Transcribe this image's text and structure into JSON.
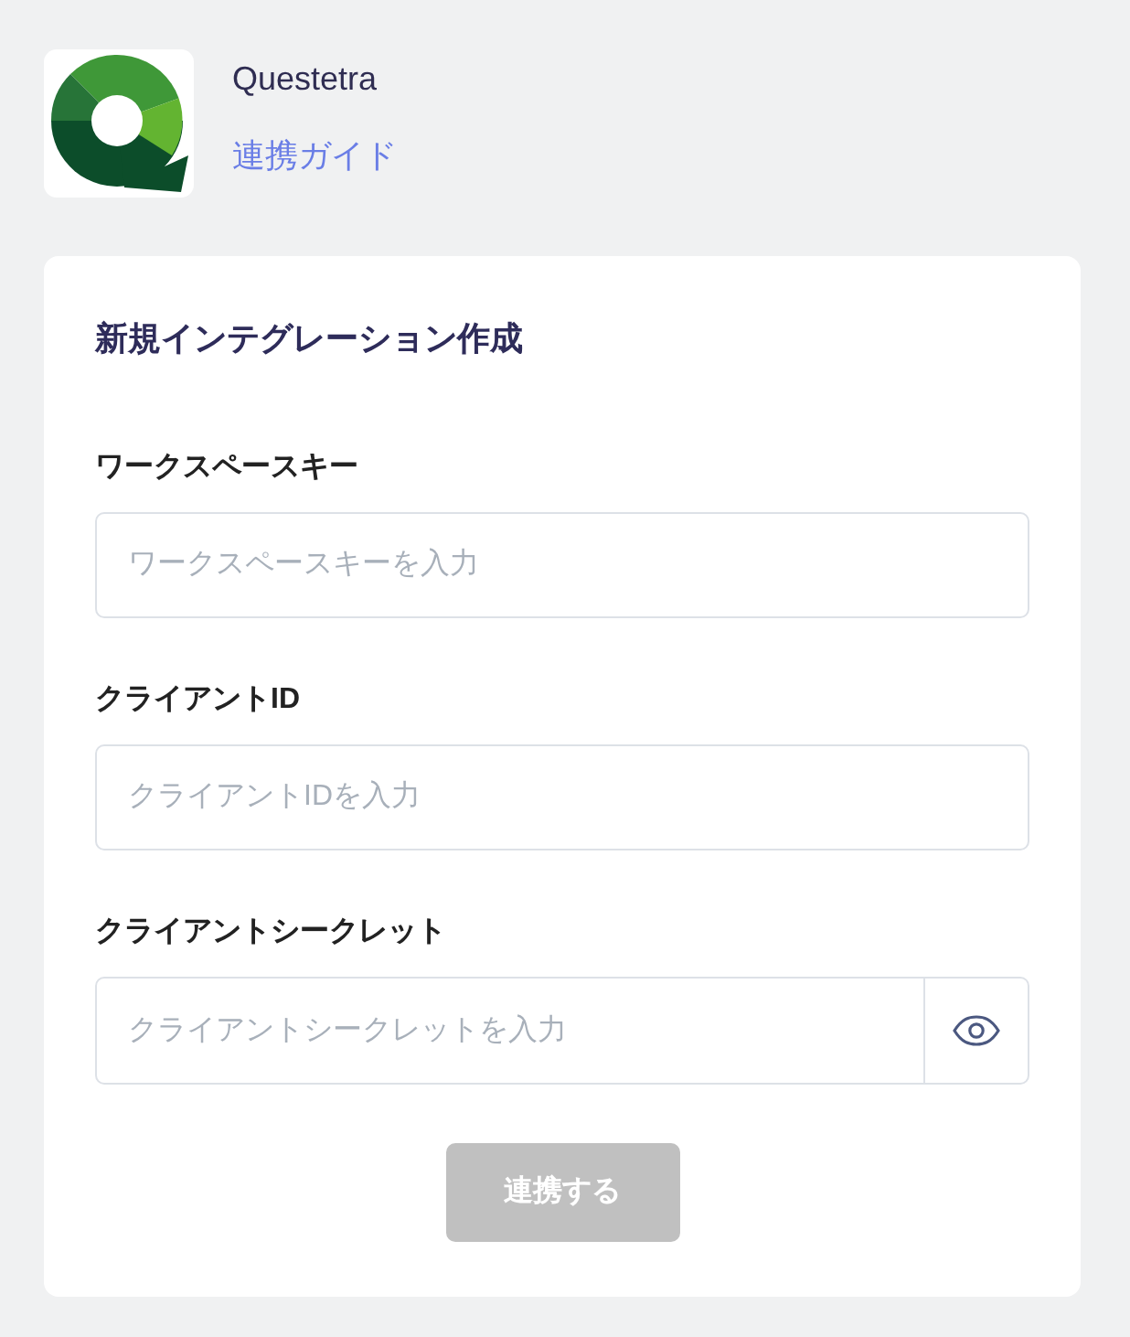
{
  "header": {
    "app_name": "Questetra",
    "guide_link": "連携ガイド"
  },
  "form": {
    "title": "新規インテグレーション作成",
    "fields": [
      {
        "kind": "text",
        "label": "ワークスペースキー",
        "placeholder": "ワークスペースキーを入力"
      },
      {
        "kind": "text",
        "label": "クライアントID",
        "placeholder": "クライアントIDを入力"
      },
      {
        "kind": "secret",
        "label": "クライアントシークレット",
        "placeholder": "クライアントシークレットを入力"
      }
    ],
    "submit": {
      "label": "連携する",
      "disabled": true
    }
  }
}
